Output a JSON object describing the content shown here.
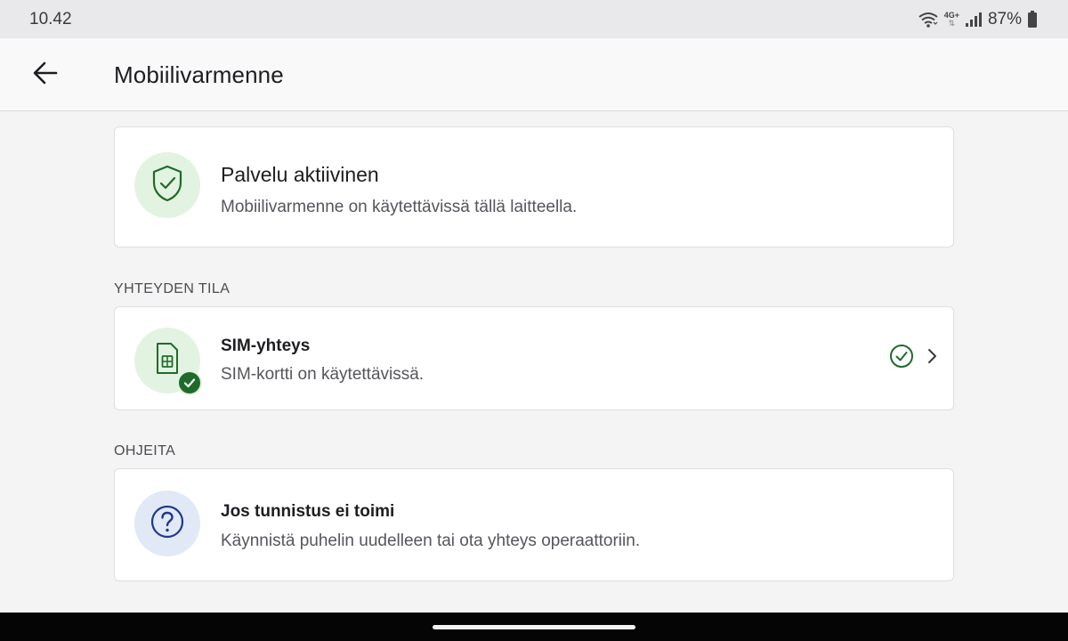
{
  "status_bar": {
    "time": "10.42",
    "network": "4G+",
    "battery": "87%"
  },
  "app_bar": {
    "title": "Mobiilivarmenne",
    "back_icon": "arrow-left-icon"
  },
  "service_card": {
    "icon": "shield-check-icon",
    "title": "Palvelu aktiivinen",
    "subtitle": "Mobiilivarmenne on käytettävissä tällä laitteella."
  },
  "connection_section": {
    "label": "YHTEYDEN TILA",
    "item": {
      "icon": "sim-card-icon",
      "badge_icon": "check-badge-icon",
      "title": "SIM-yhteys",
      "subtitle": "SIM-kortti on käytettävissä.",
      "status_icon": "check-circle-icon",
      "chevron_icon": "chevron-right-icon"
    }
  },
  "help_section": {
    "label": "OHJEITA",
    "item": {
      "icon": "question-circle-icon",
      "title": "Jos tunnistus ei toimi",
      "subtitle": "Käynnistä puhelin uudelleen tai ota yhteys operaattoriin."
    }
  },
  "colors": {
    "accent_green": "#1f6b2b",
    "accent_blue": "#1e3a8a",
    "green_tint": "#e3f3e1",
    "blue_tint": "#e1e9f7"
  }
}
